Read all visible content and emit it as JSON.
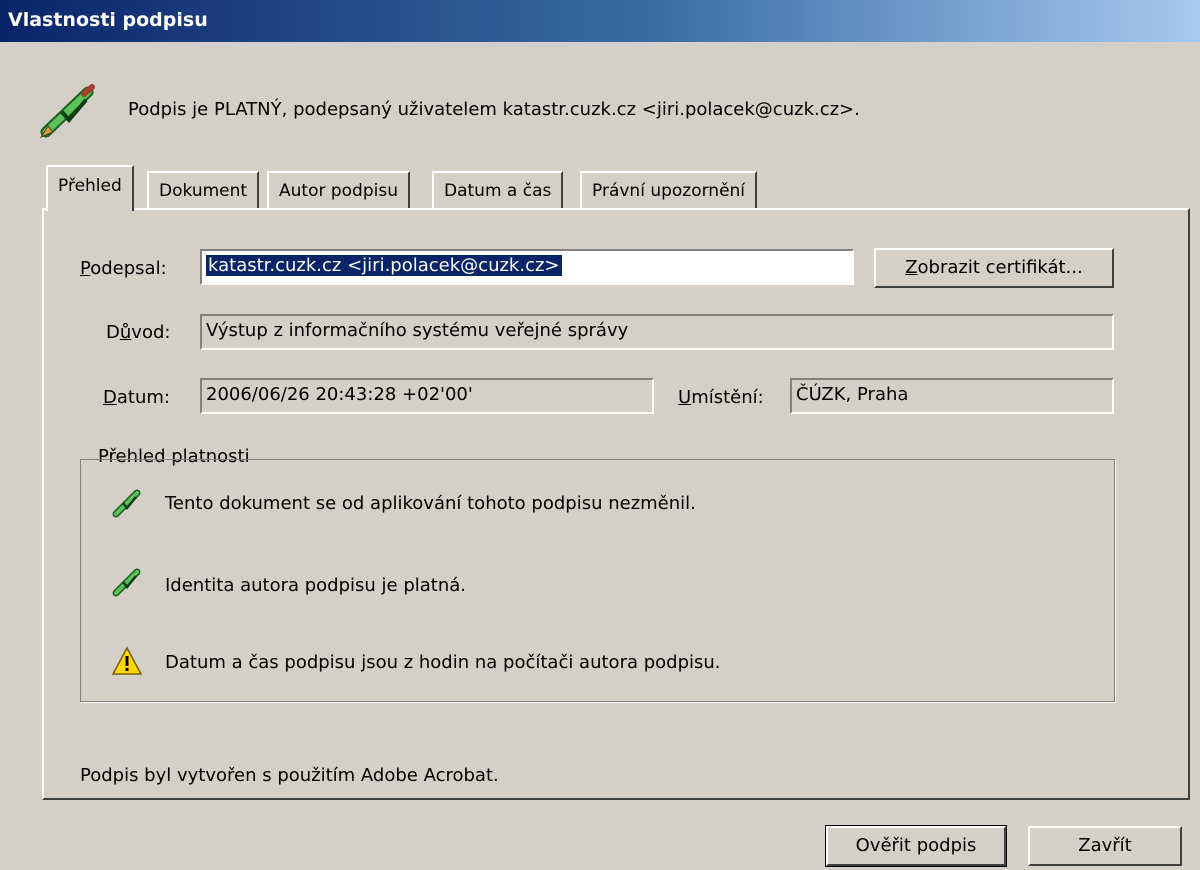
{
  "window": {
    "title": "Vlastnosti podpisu"
  },
  "status": {
    "icon": "signature-valid-icon",
    "text": "Podpis je PLATNÝ, podepsaný uživatelem katastr.cuzk.cz <jiri.polacek@cuzk.cz>."
  },
  "tabs": [
    {
      "label": "Přehled",
      "active": true
    },
    {
      "label": "Dokument",
      "active": false
    },
    {
      "label": "Autor podpisu",
      "active": false
    },
    {
      "label": "Datum a čas",
      "active": false
    },
    {
      "label": "Právní upozornění",
      "active": false
    }
  ],
  "overview": {
    "signed_by": {
      "label_mnemonic": "P",
      "label_rest": "odepsal:",
      "value": "katastr.cuzk.cz <jiri.polacek@cuzk.cz>"
    },
    "show_certificate": {
      "mnemonic": "Z",
      "rest": "obrazit certifikát..."
    },
    "reason": {
      "label_pre": "D",
      "label_mnemonic": "ů",
      "label_rest": "vod:",
      "value": "Výstup z informačního systému veřejné správy"
    },
    "date": {
      "label_mnemonic": "D",
      "label_rest": "atum:",
      "value": "2006/06/26 20:43:28 +02'00'"
    },
    "location": {
      "label_mnemonic": "U",
      "label_rest": "místění:",
      "value": "ČÚZK, Praha"
    },
    "validity": {
      "title": "Přehled platnosti",
      "items": [
        {
          "icon": "signature-valid-icon",
          "text": "Tento dokument se od aplikování tohoto podpisu nezměnil."
        },
        {
          "icon": "signature-valid-icon",
          "text": "Identita autora podpisu je platná."
        },
        {
          "icon": "warning-icon",
          "text": "Datum a čas podpisu jsou z hodin na počítači autora podpisu."
        }
      ]
    },
    "footer_note": "Podpis byl vytvořen s použitím Adobe Acrobat."
  },
  "buttons": {
    "verify": "Ověřit podpis",
    "close": "Zavřít"
  },
  "colors": {
    "dialog_bg": "#d4d0c8",
    "titlebar_start": "#0a246a",
    "titlebar_end": "#a6caf0",
    "selection": "#0a246a",
    "pen_green": "#3c9a3c"
  }
}
